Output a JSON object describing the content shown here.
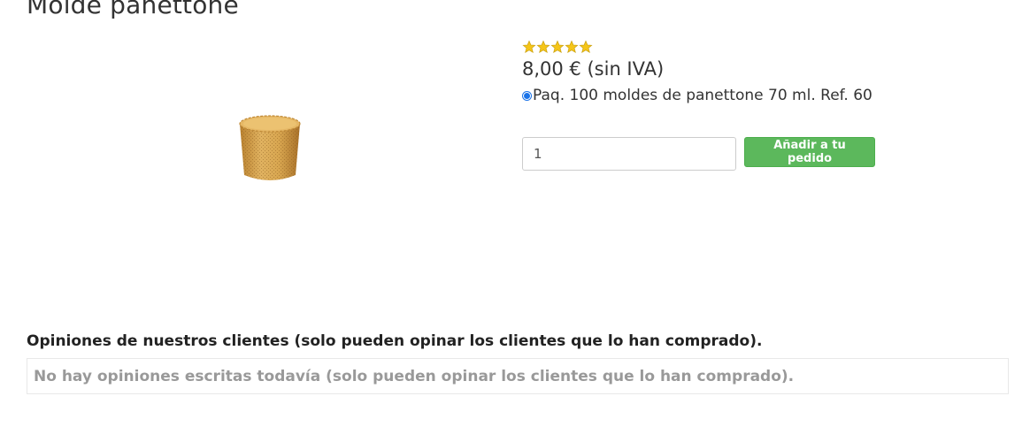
{
  "product": {
    "title": "Molde panettone",
    "rating_stars": 5,
    "rating_max": 5,
    "price": "8,00 € (sin IVA)",
    "variant_label": "Paq. 100 moldes de panettone 70 ml. Ref. 60",
    "variant_selected": true,
    "image_icon": "panettone-mold-image"
  },
  "order": {
    "quantity": "1",
    "add_button_label": "Añadir a tu pedido"
  },
  "reviews": {
    "heading": "Opiniones de nuestros clientes (solo pueden opinar los clientes que lo han comprado).",
    "empty_message": "No hay opiniones escritas todavía (solo pueden opinar los clientes que lo han comprado)."
  },
  "colors": {
    "star": "#f5c518",
    "button": "#5cb85c",
    "radio": "#1a73e8"
  }
}
